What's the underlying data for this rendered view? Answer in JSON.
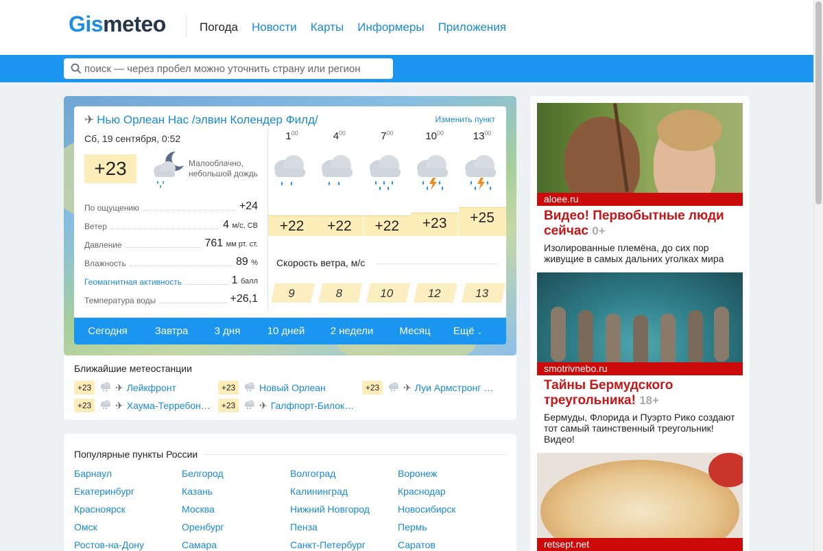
{
  "header": {
    "logo_gis": "Gis",
    "logo_meteo": "meteo",
    "nav": [
      {
        "label": "Погода",
        "active": true
      },
      {
        "label": "Новости"
      },
      {
        "label": "Карты"
      },
      {
        "label": "Информеры"
      },
      {
        "label": "Приложения"
      }
    ]
  },
  "search": {
    "placeholder": "поиск — через пробел можно уточнить страну или регион"
  },
  "weather": {
    "location": "Нью Орлеан Нас /элвин Колендер Филд/",
    "change_label": "Изменить пункт",
    "date": "Сб, 19 сентября, 0:52",
    "now_temp": "+23",
    "now_desc_line1": "Малооблачно,",
    "now_desc_line2": "небольшой дождь",
    "params": [
      {
        "label": "По ощущению",
        "value": "+24",
        "unit": ""
      },
      {
        "label": "Ветер",
        "value": "4",
        "unit": "м/с, СВ"
      },
      {
        "label": "Давление",
        "value": "761",
        "unit": "мм рт. ст."
      },
      {
        "label": "Влажность",
        "value": "89",
        "unit": "%"
      },
      {
        "label": "Геомагнитная активность",
        "value": "1",
        "unit": "балл",
        "link": true
      },
      {
        "label": "Температура воды",
        "value": "+26,1",
        "unit": ""
      }
    ],
    "hours": [
      {
        "hour": "1",
        "min": "00",
        "temp": "+22",
        "wind": "9",
        "icon": "rain-icon"
      },
      {
        "hour": "4",
        "min": "00",
        "temp": "+22",
        "wind": "8",
        "icon": "rain-icon"
      },
      {
        "hour": "7",
        "min": "00",
        "temp": "+22",
        "wind": "10",
        "icon": "heavy-rain-icon"
      },
      {
        "hour": "10",
        "min": "00",
        "temp": "+23",
        "wind": "12",
        "icon": "thunderstorm-icon"
      },
      {
        "hour": "13",
        "min": "00",
        "temp": "+25",
        "wind": "13",
        "icon": "thunderstorm-icon"
      }
    ],
    "wind_title": "Скорость ветра, м/с",
    "tabs": [
      "Сегодня",
      "Завтра",
      "3 дня",
      "10 дней",
      "2 недели",
      "Месяц",
      "Ещё"
    ]
  },
  "stations": {
    "title": "Ближайшие метеостанции",
    "items": [
      {
        "temp": "+23",
        "name": "Лейкфронт",
        "plane": true
      },
      {
        "temp": "+23",
        "name": "Новый Орлеан",
        "plane": false
      },
      {
        "temp": "+23",
        "name": "Луи Армстронг …",
        "plane": true
      },
      {
        "temp": "+23",
        "name": "Хаума-Терребон…",
        "plane": true
      },
      {
        "temp": "+23",
        "name": "Галфпорт-Билок…",
        "plane": true
      }
    ]
  },
  "popular": {
    "title": "Популярные пункты России",
    "cities": [
      "Барнаул",
      "Белгород",
      "Волгоград",
      "Воронеж",
      "Екатеринбург",
      "Казань",
      "Калининград",
      "Краснодар",
      "Красноярск",
      "Москва",
      "Нижний Новгород",
      "Новосибирск",
      "Омск",
      "Оренбург",
      "Пенза",
      "Пермь",
      "Ростов-на-Дону",
      "Самара",
      "Санкт-Петербург",
      "Саратов"
    ]
  },
  "ads": [
    {
      "source": "aloee.ru",
      "title": "Видео! Первобытные люди сейчас",
      "age": "0+",
      "text": "Изолированные племёна, до сих пор живущие в самых дальних уголках мира"
    },
    {
      "source": "smotrivnebo.ru",
      "title": "Тайны Бермудского треугольника!",
      "age": "18+",
      "text": "Бермуды, Флорида и Пуэрто Рико создают тот самый таинственный треугольник! Видео!"
    },
    {
      "source": "retsept.net",
      "title": "",
      "age": "",
      "text": ""
    }
  ]
}
